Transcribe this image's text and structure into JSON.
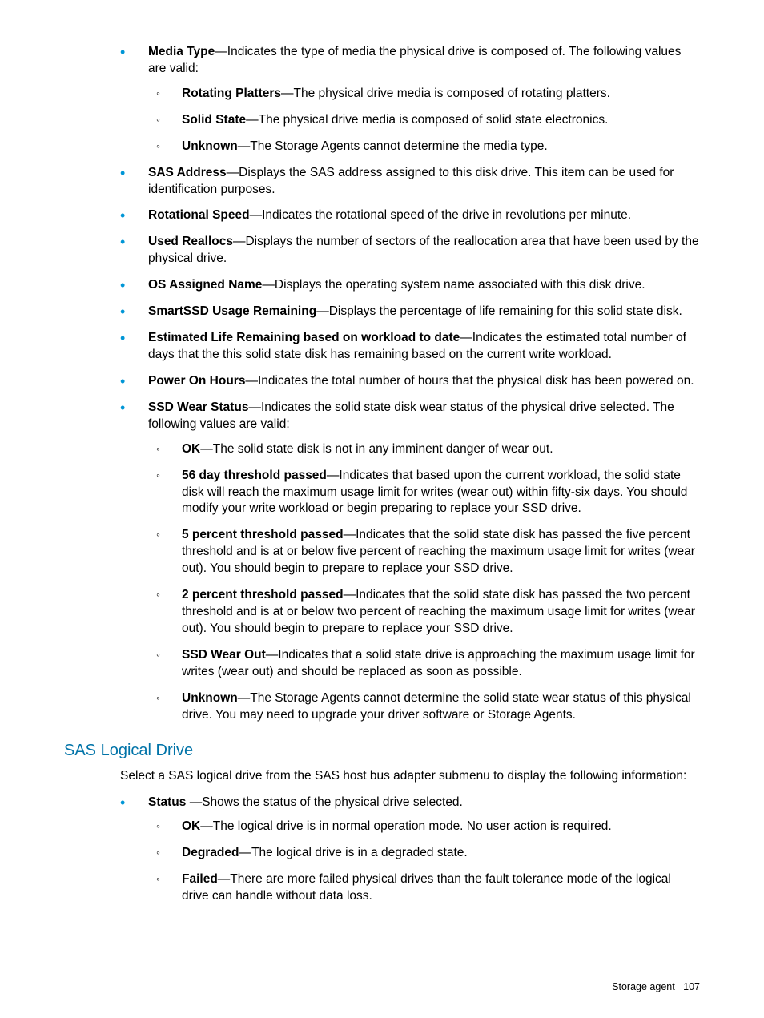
{
  "bullets1": [
    {
      "term": "Media Type",
      "desc": "—Indicates the type of media the physical drive is composed of. The following values are valid:",
      "sub": [
        {
          "term": "Rotating Platters",
          "desc": "—The physical drive media is composed of rotating platters."
        },
        {
          "term": "Solid State",
          "desc": "—The physical drive media is composed of solid state electronics."
        },
        {
          "term": "Unknown",
          "desc": "—The Storage Agents cannot determine the media type."
        }
      ]
    },
    {
      "term": "SAS Address",
      "desc": "—Displays the SAS address assigned to this disk drive. This item can be used for identification purposes."
    },
    {
      "term": "Rotational Speed",
      "desc": "—Indicates the rotational speed of the drive in revolutions per minute."
    },
    {
      "term": "Used Reallocs",
      "desc": "—Displays the number of sectors of the reallocation area that have been used by the physical drive."
    },
    {
      "term": "OS Assigned Name",
      "desc": "—Displays the operating system name associated with this disk drive."
    },
    {
      "term": "SmartSSD Usage Remaining",
      "desc": "—Displays the percentage of life remaining for this solid state disk."
    },
    {
      "term": "Estimated Life Remaining based on workload to date",
      "desc": "—Indicates the estimated total number of days that the this solid state disk has remaining based on the current write workload."
    },
    {
      "term": "Power On Hours",
      "desc": "—Indicates the total number of hours that the physical disk has been powered on."
    },
    {
      "term": "SSD Wear Status",
      "desc": "—Indicates the solid state disk wear status of the physical drive selected. The following values are valid:",
      "sub": [
        {
          "term": "OK",
          "desc": "—The solid state disk is not in any imminent danger of wear out."
        },
        {
          "term": "56 day threshold passed",
          "desc": "—Indicates that based upon the current workload, the solid state disk will reach the maximum usage limit for writes (wear out) within fifty-six days. You should modify your write workload or begin preparing to replace your SSD drive."
        },
        {
          "term": "5 percent threshold passed",
          "desc": "—Indicates that the solid state disk has passed the five percent threshold and is at or below five percent of reaching the maximum usage limit for writes (wear out). You should begin to prepare to replace your SSD drive."
        },
        {
          "term": "2 percent threshold passed",
          "desc": "—Indicates that the solid state disk has passed the two percent threshold and is at or below two percent of reaching the maximum usage limit for writes (wear out). You should begin to prepare to replace your SSD drive."
        },
        {
          "term": "SSD Wear Out",
          "desc": "—Indicates that a solid state drive is approaching the maximum usage limit for writes (wear out) and should be replaced as soon as possible."
        },
        {
          "term": "Unknown",
          "desc": "—The Storage Agents cannot determine the solid state wear status of this physical drive. You may need to upgrade your driver software or Storage Agents."
        }
      ]
    }
  ],
  "section2": {
    "heading": "SAS Logical Drive",
    "intro": "Select a SAS logical drive from the SAS host bus adapter submenu to display the following information:"
  },
  "bullets2": [
    {
      "term": "Status ",
      "desc": "—Shows the status of the physical drive selected.",
      "sub": [
        {
          "term": "OK",
          "desc": "—The logical drive is in normal operation mode. No user action is required."
        },
        {
          "term": "Degraded",
          "desc": "—The logical drive is in a degraded state."
        },
        {
          "term": "Failed",
          "desc": "—There are more failed physical drives than the fault tolerance mode of the logical drive can handle without data loss."
        }
      ]
    }
  ],
  "footer": {
    "left": "Storage agent",
    "right": "107"
  }
}
